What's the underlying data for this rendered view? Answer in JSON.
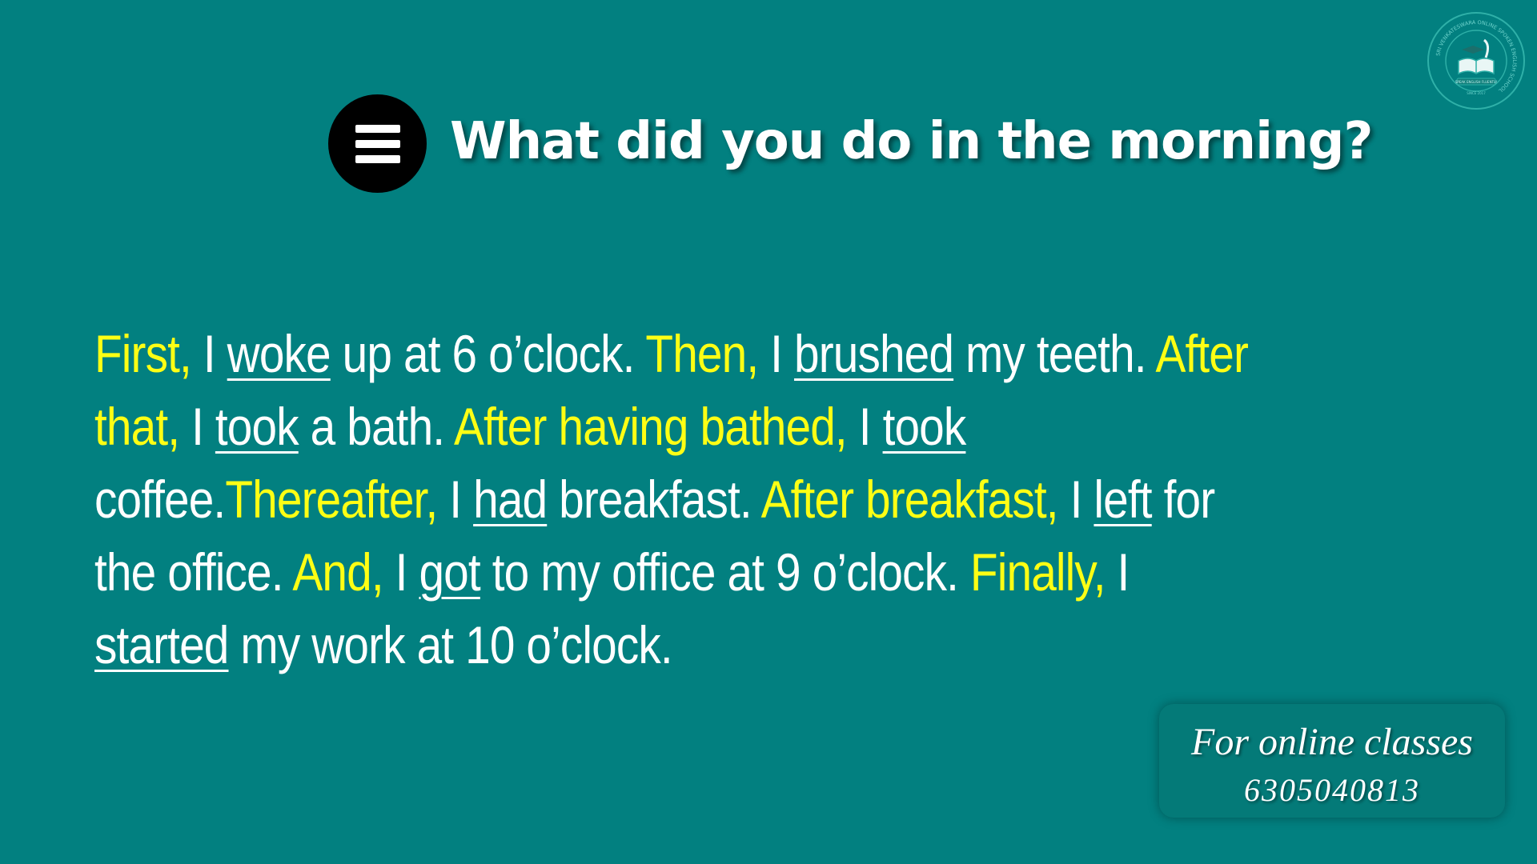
{
  "header": {
    "title": "What did you do in the morning?",
    "icon": "menu-icon"
  },
  "paragraph": {
    "segments": [
      {
        "text": "First,",
        "style": "highlight"
      },
      {
        "text": " I ",
        "style": "plain"
      },
      {
        "text": "woke",
        "style": "underline"
      },
      {
        "text": " up at 6 o’clock. ",
        "style": "plain"
      },
      {
        "text": "Then,",
        "style": "highlight"
      },
      {
        "text": " I ",
        "style": "plain"
      },
      {
        "text": "brushed",
        "style": "underline"
      },
      {
        "text": " my teeth. ",
        "style": "plain"
      },
      {
        "text": "After that,",
        "style": "highlight"
      },
      {
        "text": " I ",
        "style": "plain"
      },
      {
        "text": "took",
        "style": "underline"
      },
      {
        "text": " a bath. ",
        "style": "plain"
      },
      {
        "text": "After having bathed,",
        "style": "highlight"
      },
      {
        "text": " I ",
        "style": "plain"
      },
      {
        "text": "took",
        "style": "underline"
      },
      {
        "text": " coffee.",
        "style": "plain"
      },
      {
        "text": "Thereafter,",
        "style": "highlight"
      },
      {
        "text": " I ",
        "style": "plain"
      },
      {
        "text": "had",
        "style": "underline"
      },
      {
        "text": " breakfast. ",
        "style": "plain"
      },
      {
        "text": "After breakfast,",
        "style": "highlight"
      },
      {
        "text": " I ",
        "style": "plain"
      },
      {
        "text": "left",
        "style": "underline"
      },
      {
        "text": " for the office. ",
        "style": "plain"
      },
      {
        "text": "And,",
        "style": "highlight"
      },
      {
        "text": " I ",
        "style": "plain"
      },
      {
        "text": "got",
        "style": "underline"
      },
      {
        "text": " to my office at 9 o’clock. ",
        "style": "plain"
      },
      {
        "text": "Finally,",
        "style": "highlight"
      },
      {
        "text": " I ",
        "style": "plain"
      },
      {
        "text": "started",
        "style": "underline"
      },
      {
        "text": " my work at 10 o’clock.",
        "style": "plain"
      }
    ]
  },
  "contact": {
    "line1": "For online classes",
    "line2": "6305040813"
  },
  "logo": {
    "name": "school-logo-icon",
    "ring_text": "SRI VENKATESWARA ONLINE SPOKEN ENGLISH SCHOOL",
    "banner_text": "SPEAK ENGLISH FLUENTLY",
    "since_text": "SINCE 2017"
  },
  "colors": {
    "background": "#028080",
    "highlight": "#ffff14",
    "text": "#ffffff",
    "icon_background": "#000000"
  }
}
